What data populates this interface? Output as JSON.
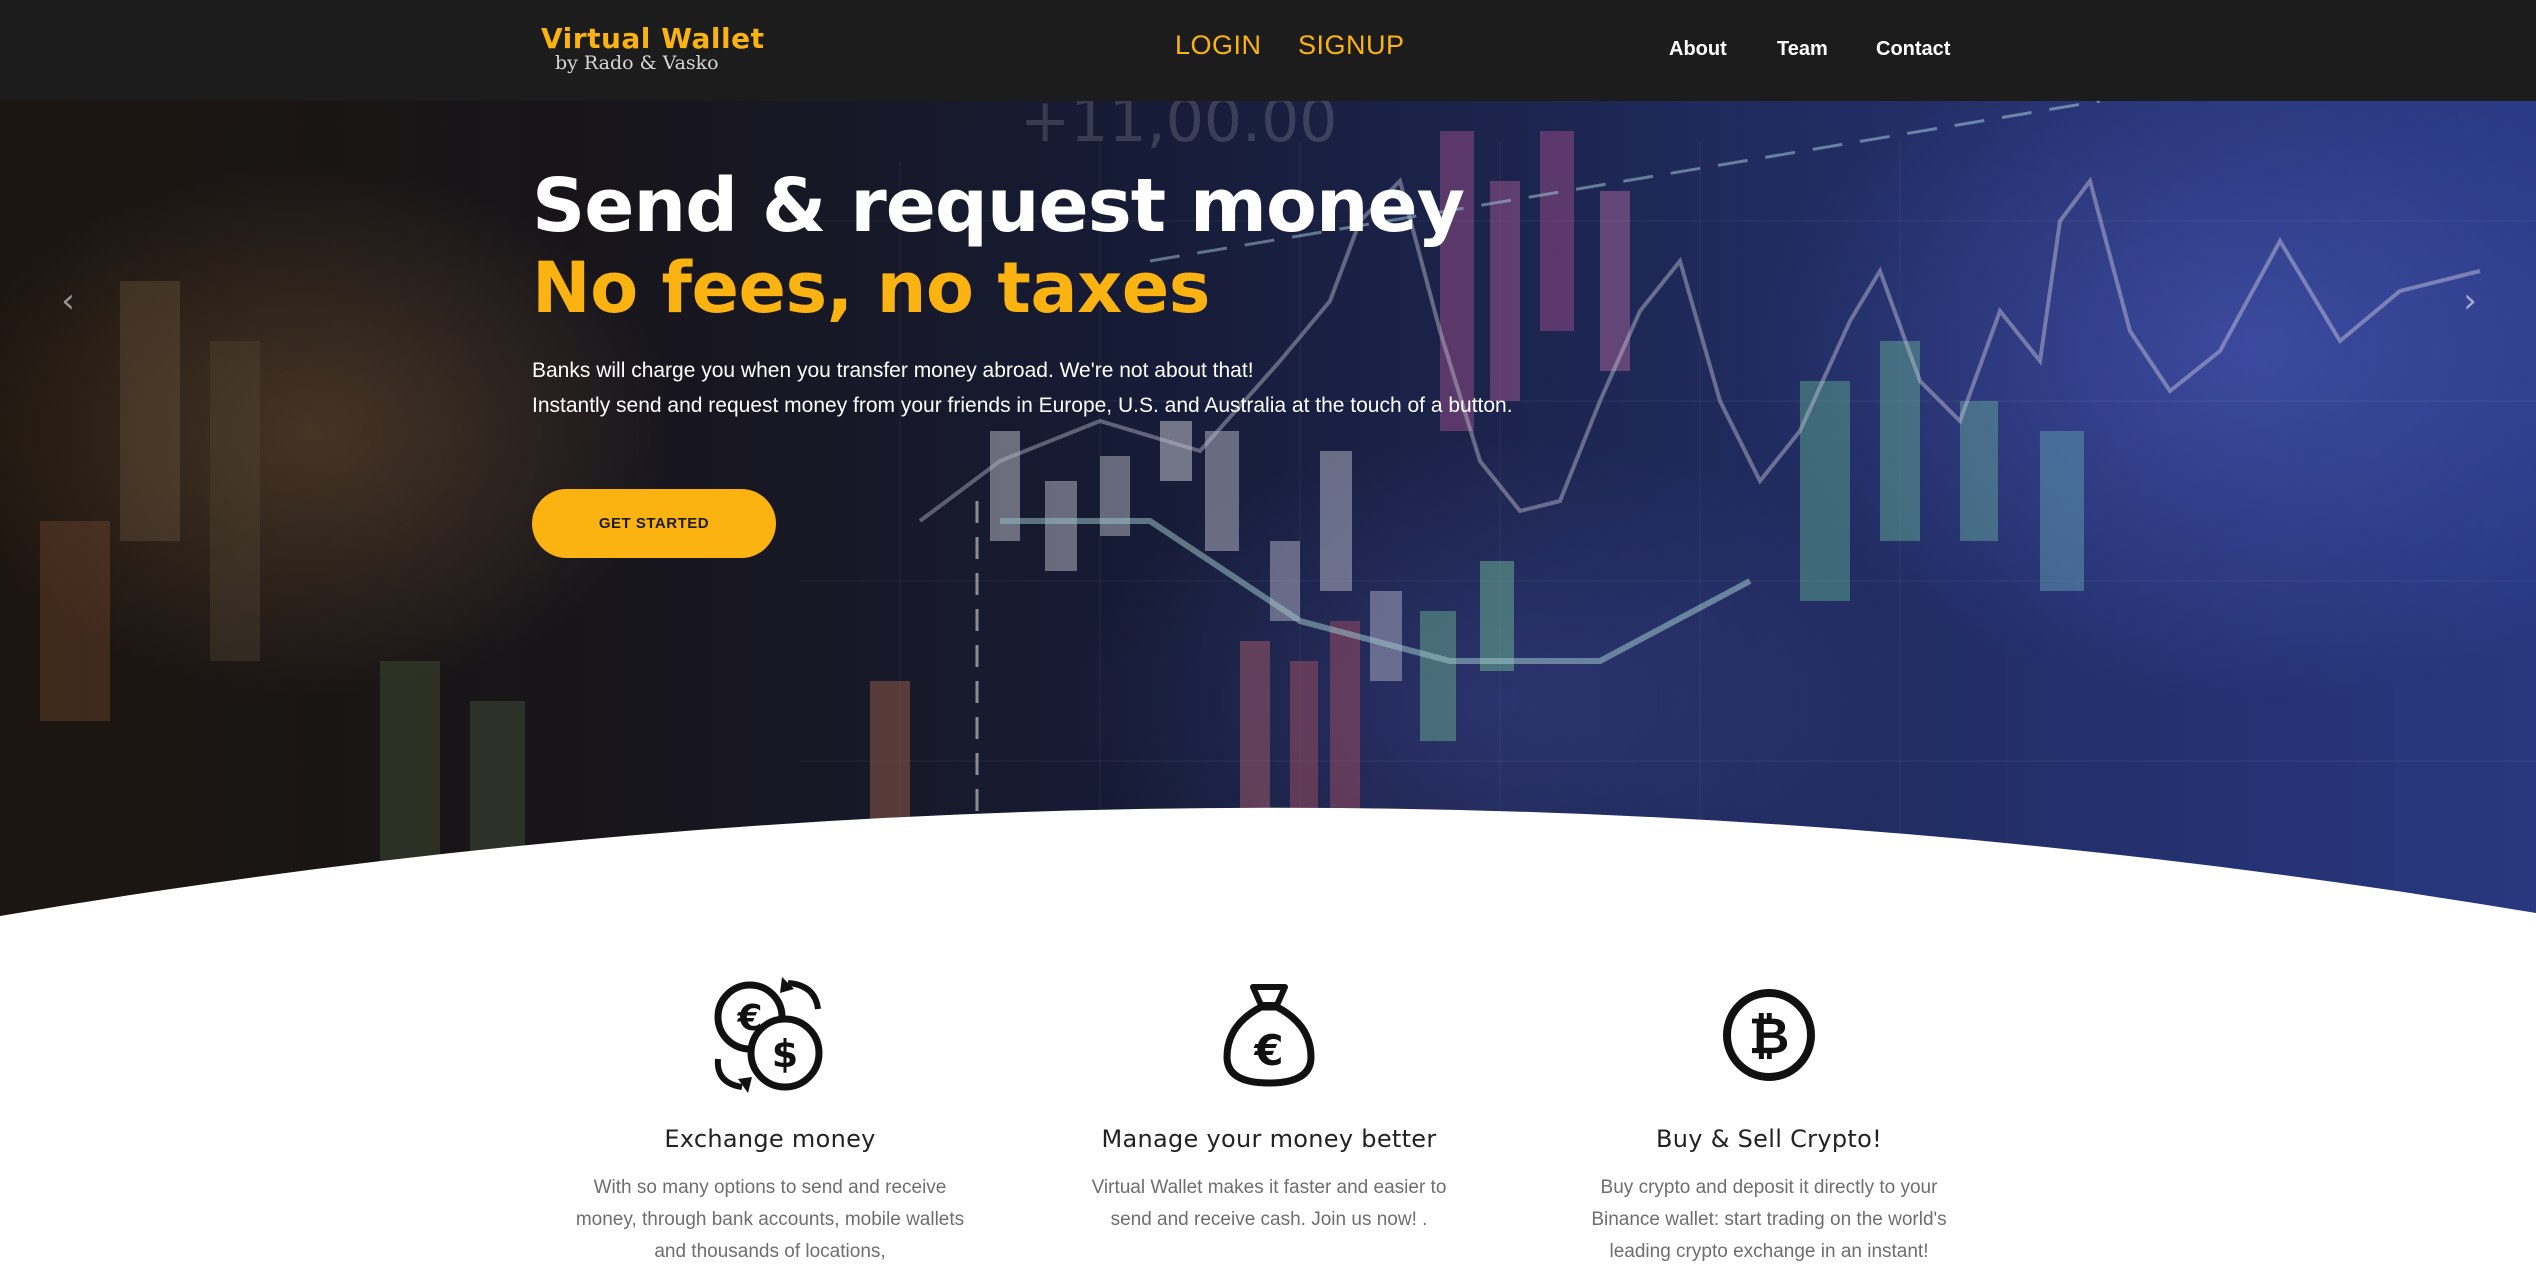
{
  "navbar": {
    "brand_title": "Virtual Wallet",
    "brand_subtitle": "by Rado & Vasko",
    "login": "LOGIN",
    "signup": "SIGNUP",
    "links": [
      "About",
      "Team",
      "Contact"
    ]
  },
  "hero": {
    "title": "Send & request money",
    "subtitle": "No fees, no taxes",
    "description_lines": [
      "Banks will charge you when you transfer money abroad. We're not about that!",
      "Instantly send and request money from your friends in Europe, U.S. and Australia at the touch of a button."
    ],
    "cta_label": "GET STARTED",
    "prev_arrow": "‹",
    "next_arrow": "›"
  },
  "features": [
    {
      "icon": "currency-exchange-icon",
      "title": "Exchange money",
      "text_lines": [
        "With so many options to send and receive",
        "money, through bank accounts, mobile wallets",
        "and thousands of locations,"
      ]
    },
    {
      "icon": "money-bag-icon",
      "title": "Manage your money better",
      "text_lines": [
        "Virtual Wallet makes it faster and easier to",
        "send and receive cash. Join us now! ."
      ]
    },
    {
      "icon": "bitcoin-icon",
      "title": "Buy & Sell Crypto!",
      "text_lines": [
        "Buy crypto and deposit it directly to your",
        "Binance wallet: start trading on the world's",
        "leading crypto exchange in an instant!"
      ]
    }
  ],
  "colors": {
    "accent": "#fbb311",
    "navbar_bg": "#1c1c1c",
    "text_dark": "#222222",
    "text_muted": "#6e6e6e"
  }
}
